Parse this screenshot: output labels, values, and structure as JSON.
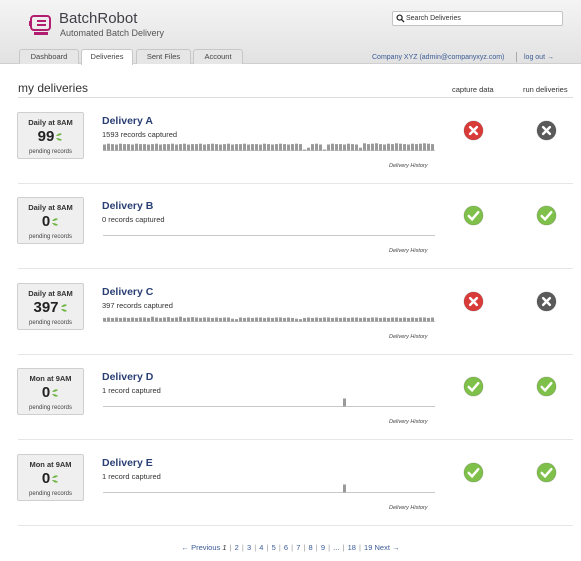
{
  "brand": {
    "name": "BatchRobot",
    "tagline": "Automated Batch Delivery",
    "icon": "robot-logo-icon",
    "color": "#b21e6f"
  },
  "search": {
    "placeholder": "Search Deliveries",
    "icon": "search-icon"
  },
  "tabs": [
    {
      "label": "Dashboard",
      "active": false
    },
    {
      "label": "Deliveries",
      "active": true
    },
    {
      "label": "Sent Files",
      "active": false
    },
    {
      "label": "Account",
      "active": false
    }
  ],
  "user": {
    "company": "Company XYZ (admin@companyxyz.com)",
    "logout": "log out →"
  },
  "section": {
    "title": "my deliveries",
    "capture_header": "capture data",
    "run_header": "run deliveries"
  },
  "colors": {
    "error": "#d93b38",
    "ok": "#7fc04a",
    "muted": "#5a5a5a",
    "link": "#2a3f73"
  },
  "deliveries": [
    {
      "schedule": "Daily at 8AM",
      "count": "99",
      "pending_label": "pending records",
      "name": "Delivery A",
      "records": "1593 records captured",
      "history": "Delivery History",
      "capture_status": "error",
      "run_status": "disabled",
      "activity": [
        0.75,
        0.85,
        0.8,
        0.75,
        0.85,
        0.8,
        0.8,
        0.75,
        0.85,
        0.8,
        0.8,
        0.75,
        0.8,
        0.85,
        0.75,
        0.8,
        0.8,
        0.85,
        0.75,
        0.8,
        0.85,
        0.75,
        0.8,
        0.8,
        0.85,
        0.75,
        0.8,
        0.85,
        0.8,
        0.75,
        0.8,
        0.85,
        0.75,
        0.8,
        0.8,
        0.85,
        0.75,
        0.8,
        0.8,
        0.75,
        0.85,
        0.8,
        0.75,
        0.8,
        0.85,
        0.8,
        0.75,
        0.8,
        0.85,
        0.8,
        0.1,
        0.35,
        0.8,
        0.85,
        0.75,
        0.1,
        0.75,
        0.85,
        0.8,
        0.8,
        0.75,
        0.85,
        0.8,
        0.75,
        0.35,
        0.9,
        0.8,
        0.85,
        0.9,
        0.8,
        0.75,
        0.85,
        0.8,
        0.9,
        0.85,
        0.8,
        0.75,
        0.85,
        0.8,
        0.85,
        0.9,
        0.85,
        0.8
      ]
    },
    {
      "schedule": "Daily at 8AM",
      "count": "0",
      "pending_label": "pending records",
      "name": "Delivery B",
      "records": "0 records captured",
      "history": "Delivery History",
      "capture_status": "ok",
      "run_status": "ok",
      "activity": [
        0,
        0,
        0,
        0,
        0,
        0,
        0,
        0,
        0,
        0,
        0,
        0,
        0,
        0,
        0,
        0,
        0,
        0,
        0,
        0,
        0,
        0,
        0,
        0,
        0,
        0,
        0,
        0,
        0,
        0,
        0,
        0,
        0,
        0,
        0,
        0,
        0,
        0,
        0,
        0,
        0,
        0,
        0,
        0,
        0,
        0,
        0,
        0,
        0,
        0,
        0,
        0,
        0,
        0,
        0,
        0,
        0,
        0,
        0,
        0,
        0,
        0,
        0,
        0,
        0,
        0,
        0,
        0,
        0,
        0,
        0,
        0,
        0,
        0,
        0,
        0,
        0,
        0,
        0,
        0,
        0,
        0,
        0
      ]
    },
    {
      "schedule": "Daily at 8AM",
      "count": "397",
      "pending_label": "pending records",
      "name": "Delivery C",
      "records": "397 records captured",
      "history": "Delivery History",
      "capture_status": "error",
      "run_status": "disabled",
      "activity": [
        0.45,
        0.5,
        0.45,
        0.5,
        0.45,
        0.5,
        0.45,
        0.5,
        0.45,
        0.5,
        0.5,
        0.45,
        0.6,
        0.5,
        0.45,
        0.5,
        0.55,
        0.45,
        0.5,
        0.6,
        0.45,
        0.5,
        0.55,
        0.5,
        0.45,
        0.5,
        0.5,
        0.45,
        0.5,
        0.45,
        0.5,
        0.5,
        0.35,
        0.3,
        0.5,
        0.45,
        0.5,
        0.45,
        0.5,
        0.5,
        0.45,
        0.5,
        0.45,
        0.5,
        0.5,
        0.45,
        0.5,
        0.45,
        0.35,
        0.3,
        0.45,
        0.5,
        0.45,
        0.5,
        0.45,
        0.5,
        0.5,
        0.45,
        0.5,
        0.45,
        0.5,
        0.45,
        0.5,
        0.5,
        0.45,
        0.5,
        0.45,
        0.5,
        0.5,
        0.45,
        0.5,
        0.45,
        0.5,
        0.5,
        0.45,
        0.5,
        0.45,
        0.5,
        0.45,
        0.5,
        0.5,
        0.45,
        0.5
      ]
    },
    {
      "schedule": "Mon at 9AM",
      "count": "0",
      "pending_label": "pending records",
      "name": "Delivery D",
      "records": "1 record captured",
      "history": "Delivery History",
      "capture_status": "ok",
      "run_status": "ok",
      "activity": [
        0,
        0,
        0,
        0,
        0,
        0,
        0,
        0,
        0,
        0,
        0,
        0,
        0,
        0,
        0,
        0,
        0,
        0,
        0,
        0,
        0,
        0,
        0,
        0,
        0,
        0,
        0,
        0,
        0,
        0,
        0,
        0,
        0,
        0,
        0,
        0,
        0,
        0,
        0,
        0,
        0,
        0,
        0,
        0,
        0,
        0,
        0,
        0,
        0,
        0,
        0,
        0,
        0,
        0,
        0,
        0,
        0,
        0,
        0,
        0,
        1,
        0,
        0,
        0,
        0,
        0,
        0,
        0,
        0,
        0,
        0,
        0,
        0,
        0,
        0,
        0,
        0,
        0,
        0,
        0,
        0,
        0,
        0
      ]
    },
    {
      "schedule": "Mon at 9AM",
      "count": "0",
      "pending_label": "pending records",
      "name": "Delivery E",
      "records": "1 record captured",
      "history": "Delivery History",
      "capture_status": "ok",
      "run_status": "ok",
      "activity": [
        0,
        0,
        0,
        0,
        0,
        0,
        0,
        0,
        0,
        0,
        0,
        0,
        0,
        0,
        0,
        0,
        0,
        0,
        0,
        0,
        0,
        0,
        0,
        0,
        0,
        0,
        0,
        0,
        0,
        0,
        0,
        0,
        0,
        0,
        0,
        0,
        0,
        0,
        0,
        0,
        0,
        0,
        0,
        0,
        0,
        0,
        0,
        0,
        0,
        0,
        0,
        0,
        0,
        0,
        0,
        0,
        0,
        0,
        0,
        0,
        1,
        0,
        0,
        0,
        0,
        0,
        0,
        0,
        0,
        0,
        0,
        0,
        0,
        0,
        0,
        0,
        0,
        0,
        0,
        0,
        0,
        0,
        0
      ]
    }
  ],
  "pagination": {
    "prev": "← Previous",
    "current": "1",
    "pages": [
      "2",
      "3",
      "4",
      "5",
      "6",
      "7",
      "8",
      "9",
      "...",
      "18",
      "19"
    ],
    "next": "Next →"
  }
}
